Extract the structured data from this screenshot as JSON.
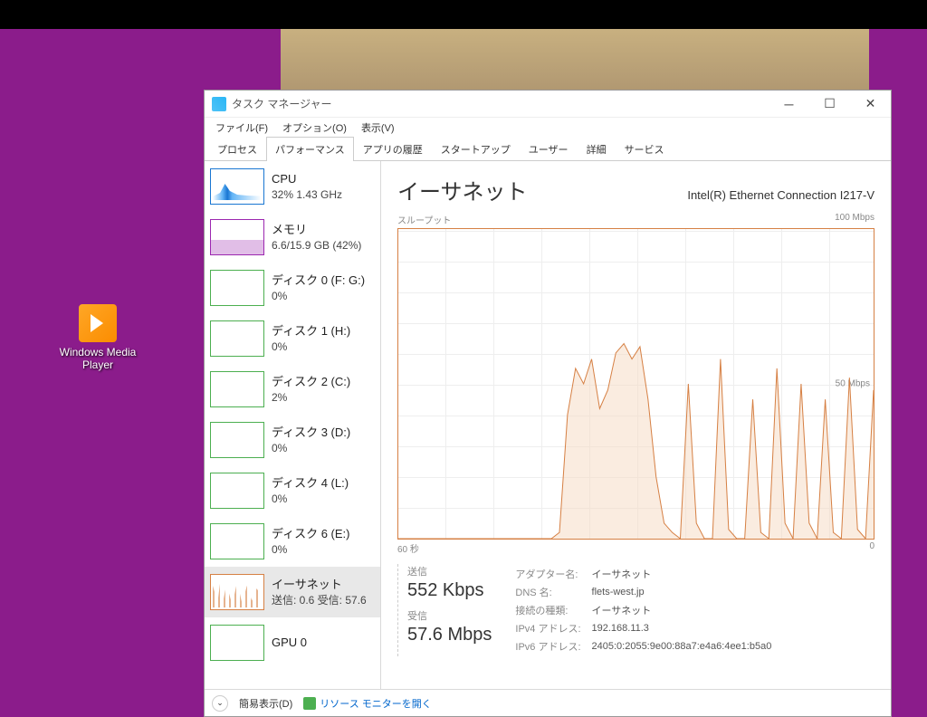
{
  "desktop": {
    "icon_label": "Windows Media\nPlayer"
  },
  "window": {
    "title": "タスク マネージャー",
    "menu": [
      "ファイル(F)",
      "オプション(O)",
      "表示(V)"
    ],
    "tabs": [
      "プロセス",
      "パフォーマンス",
      "アプリの履歴",
      "スタートアップ",
      "ユーザー",
      "詳細",
      "サービス"
    ],
    "active_tab": 1
  },
  "sidebar": [
    {
      "name": "CPU",
      "sub": "32%  1.43 GHz",
      "thumb": "cpu"
    },
    {
      "name": "メモリ",
      "sub": "6.6/15.9 GB (42%)",
      "thumb": "mem"
    },
    {
      "name": "ディスク 0 (F: G:)",
      "sub": "0%",
      "thumb": "disk"
    },
    {
      "name": "ディスク 1 (H:)",
      "sub": "0%",
      "thumb": "disk"
    },
    {
      "name": "ディスク 2 (C:)",
      "sub": "2%",
      "thumb": "disk"
    },
    {
      "name": "ディスク 3 (D:)",
      "sub": "0%",
      "thumb": "disk"
    },
    {
      "name": "ディスク 4 (L:)",
      "sub": "0%",
      "thumb": "disk"
    },
    {
      "name": "ディスク 6 (E:)",
      "sub": "0%",
      "thumb": "disk"
    },
    {
      "name": "イーサネット",
      "sub": "送信: 0.6  受信: 57.6",
      "thumb": "eth",
      "selected": true
    },
    {
      "name": "GPU 0",
      "sub": "",
      "thumb": "disk"
    }
  ],
  "detail": {
    "title": "イーサネット",
    "device": "Intel(R) Ethernet Connection I217-V",
    "chart_label": "スループット",
    "chart_max": "100 Mbps",
    "chart_mid": "50 Mbps",
    "x_left": "60 秒",
    "x_right": "0",
    "send_label": "送信",
    "send_value": "552 Kbps",
    "recv_label": "受信",
    "recv_value": "57.6 Mbps",
    "props": [
      [
        "アダプター名:",
        "イーサネット"
      ],
      [
        "DNS 名:",
        "flets-west.jp"
      ],
      [
        "接続の種類:",
        "イーサネット"
      ],
      [
        "IPv4 アドレス:",
        "192.168.11.3"
      ],
      [
        "IPv6 アドレス:",
        "2405:0:2055:9e00:88a7:e4a6:4ee1:b5a0"
      ]
    ]
  },
  "footer": {
    "brief": "簡易表示(D)",
    "link": "リソース モニターを開く"
  },
  "chart_data": {
    "type": "area",
    "title": "スループット",
    "ylabel": "Mbps",
    "ylim": [
      0,
      100
    ],
    "xlabel": "秒",
    "xlim": [
      60,
      0
    ],
    "series": [
      {
        "name": "受信",
        "color": "#d68044",
        "values": [
          0,
          0,
          0,
          0,
          0,
          0,
          0,
          0,
          0,
          0,
          0,
          0,
          0,
          0,
          0,
          0,
          0,
          0,
          0,
          0,
          2,
          40,
          55,
          50,
          58,
          42,
          48,
          60,
          63,
          58,
          62,
          45,
          20,
          5,
          2,
          0,
          50,
          5,
          0,
          0,
          58,
          3,
          0,
          0,
          45,
          2,
          0,
          55,
          5,
          0,
          50,
          5,
          0,
          45,
          2,
          0,
          52,
          3,
          0,
          48
        ]
      },
      {
        "name": "送信",
        "color": "#d68044",
        "values": [
          0,
          0,
          0,
          0,
          0,
          0,
          0,
          0,
          0,
          0,
          0,
          0,
          0,
          0,
          0,
          0,
          0,
          0,
          0,
          0,
          0.4,
          0.5,
          0.6,
          0.5,
          0.6,
          0.5,
          0.5,
          0.6,
          0.6,
          0.6,
          0.6,
          0.5,
          0.3,
          0.2,
          0.2,
          0.1,
          0.6,
          0.2,
          0.1,
          0.1,
          0.6,
          0.2,
          0.1,
          0.1,
          0.5,
          0.2,
          0.1,
          0.6,
          0.2,
          0.1,
          0.6,
          0.2,
          0.1,
          0.5,
          0.2,
          0.1,
          0.6,
          0.2,
          0.1,
          0.6
        ]
      }
    ]
  }
}
